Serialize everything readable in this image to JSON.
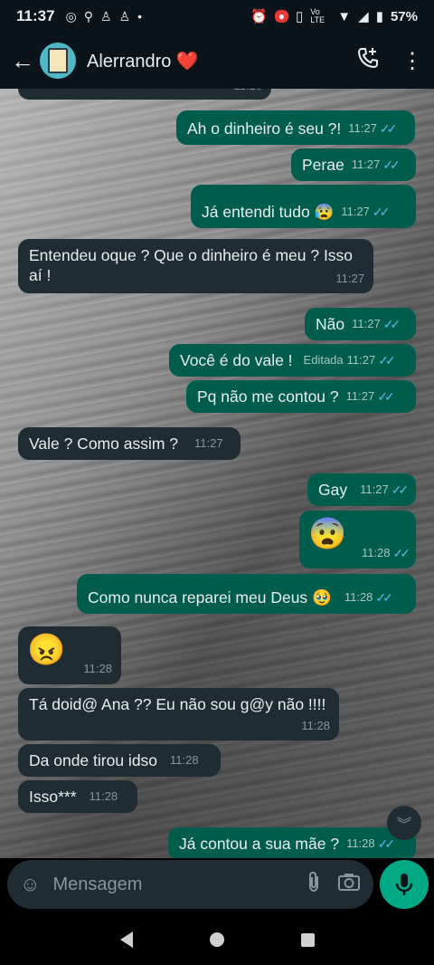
{
  "status": {
    "time": "11:37",
    "battery": "57%",
    "net": "Vo LTE"
  },
  "header": {
    "name": "Alerrandro ❤️"
  },
  "top_partial_time": "11:26",
  "messages": [
    {
      "dir": "out",
      "text": "Ah o dinheiro é seu ?!",
      "time": "11:27"
    },
    {
      "dir": "out",
      "text": "Perae",
      "time": "11:27"
    },
    {
      "dir": "out",
      "text": "Já entendi tudo 😰",
      "time": "11:27"
    },
    {
      "dir": "in",
      "text": "Entendeu oque ? Que o dinheiro é meu ? Isso aí !",
      "time": "11:27"
    },
    {
      "dir": "out",
      "text": "Não",
      "time": "11:27"
    },
    {
      "dir": "out",
      "text": "Você é do vale !",
      "time": "11:27",
      "edited": "Editada"
    },
    {
      "dir": "out",
      "text": "Pq não me contou ?",
      "time": "11:27"
    },
    {
      "dir": "in",
      "text": "Vale ? Como assim ?",
      "time": "11:27"
    },
    {
      "dir": "out",
      "text": "Gay",
      "time": "11:27"
    },
    {
      "dir": "out",
      "text": "😨",
      "time": "11:28"
    },
    {
      "dir": "out",
      "text": "Como nunca reparei meu Deus 🥹",
      "time": "11:28"
    },
    {
      "dir": "in",
      "text": "😠",
      "time": "11:28"
    },
    {
      "dir": "in",
      "text": "Tá doid@ Ana ?? Eu não sou g@y não !!!!",
      "time": "11:28"
    },
    {
      "dir": "in",
      "text": "Da onde tirou idso",
      "time": "11:28"
    },
    {
      "dir": "in",
      "text": "Isso***",
      "time": "11:28"
    },
    {
      "dir": "out",
      "text": "Já contou a sua mãe ?",
      "time": "11:28"
    }
  ],
  "composer": {
    "placeholder": "Mensagem"
  }
}
